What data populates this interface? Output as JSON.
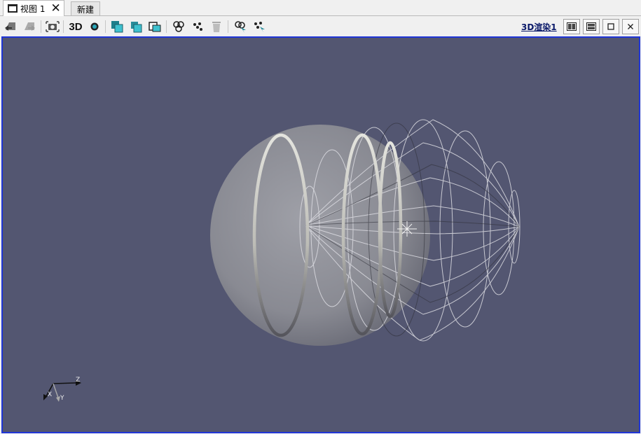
{
  "tabs": [
    {
      "label": "视图 1",
      "active": true
    },
    {
      "label": "新建",
      "active": false
    }
  ],
  "toolbar": {
    "text_3d": "3D",
    "view_label": "3D渲染1",
    "icons": [
      "reset-camera-icon",
      "redo-camera-icon",
      "screenshot-icon",
      "interaction-mode-3d",
      "point-icon",
      "select-cells-icon",
      "select-points-icon",
      "select-blocks-icon",
      "select-cells-interactive-icon",
      "select-points-interactive-icon",
      "clear-selection-icon",
      "hover-points-icon",
      "hover-cells-icon",
      "split-horizontal-icon",
      "split-vertical-icon",
      "maximize-icon",
      "close-icon"
    ]
  },
  "viewport": {
    "background": "#535671",
    "border_color": "#1f35d6",
    "axes": {
      "x": "X",
      "y": "Y",
      "z": "Z"
    }
  }
}
